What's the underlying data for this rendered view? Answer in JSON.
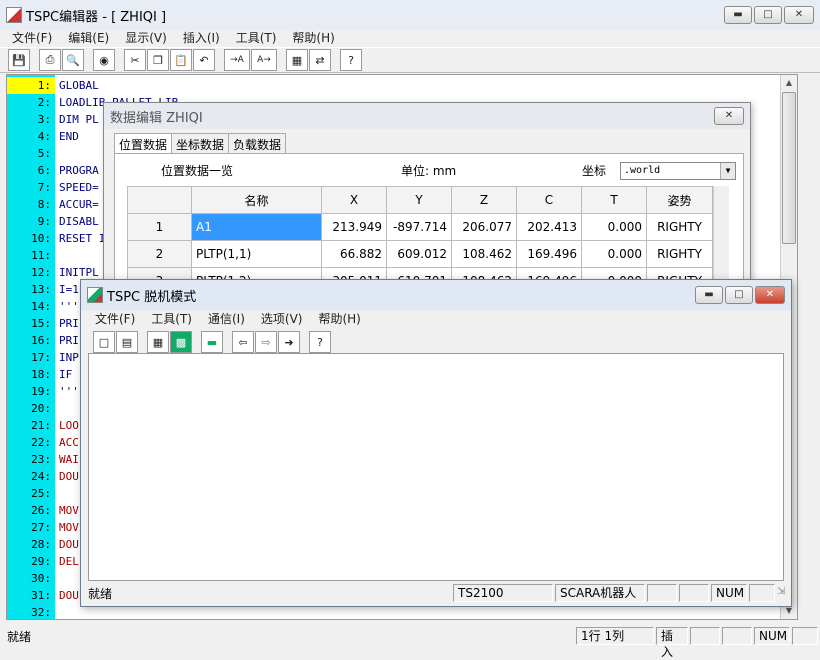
{
  "main": {
    "title": "TSPC编辑器 - [ ZHIQI ]",
    "menu": [
      "文件(F)",
      "编辑(E)",
      "显示(V)",
      "插入(I)",
      "工具(T)",
      "帮助(H)"
    ],
    "lines": [
      {
        "n": "1:",
        "code": "GLOBAL"
      },
      {
        "n": "2:",
        "code": "LOADLIB PALLET.LIB"
      },
      {
        "n": "3:",
        "code": "DIM PL"
      },
      {
        "n": "4:",
        "code": "END"
      },
      {
        "n": "5:",
        "code": ""
      },
      {
        "n": "6:",
        "code": "PROGRA"
      },
      {
        "n": "7:",
        "code": "SPEED="
      },
      {
        "n": "8:",
        "code": "ACCUR="
      },
      {
        "n": "9:",
        "code": "DISABL"
      },
      {
        "n": "10:",
        "code": "RESET I"
      },
      {
        "n": "11:",
        "code": ""
      },
      {
        "n": "12:",
        "code": "INITPL"
      },
      {
        "n": "13:",
        "code": "I=1"
      },
      {
        "n": "14:",
        "code": "'''"
      },
      {
        "n": "15:",
        "code": "PRI"
      },
      {
        "n": "16:",
        "code": "PRI"
      },
      {
        "n": "17:",
        "code": "INP"
      },
      {
        "n": "18:",
        "code": "IF"
      },
      {
        "n": "19:",
        "code": "'''"
      },
      {
        "n": "20:",
        "code": ""
      },
      {
        "n": "21:",
        "code": "LOO"
      },
      {
        "n": "22:",
        "code": "ACC"
      },
      {
        "n": "23:",
        "code": "WAI"
      },
      {
        "n": "24:",
        "code": "DOU"
      },
      {
        "n": "25:",
        "code": ""
      },
      {
        "n": "26:",
        "code": "MOV"
      },
      {
        "n": "27:",
        "code": "MOV"
      },
      {
        "n": "28:",
        "code": "DOU"
      },
      {
        "n": "29:",
        "code": "DEL"
      },
      {
        "n": "30:",
        "code": ""
      },
      {
        "n": "31:",
        "code": "DOU"
      },
      {
        "n": "32:",
        "code": ""
      }
    ],
    "status": {
      "ready": "就绪",
      "position": "1行 1列",
      "mode": "插入",
      "num": "NUM"
    }
  },
  "data_editor": {
    "title": "数据编辑 ZHIQI",
    "tabs": [
      "位置数据",
      "坐标数据",
      "负载数据"
    ],
    "list_label": "位置数据一览",
    "unit_label": "单位:  mm",
    "coord_label": "坐标",
    "coord_value": ".world",
    "columns": [
      "",
      "名称",
      "X",
      "Y",
      "Z",
      "C",
      "T",
      "姿势"
    ],
    "rows": [
      [
        "1",
        "A1",
        "213.949",
        "-897.714",
        "206.077",
        "202.413",
        "0.000",
        "RIGHTY"
      ],
      [
        "2",
        "PLTP(1,1)",
        "66.882",
        "609.012",
        "108.462",
        "169.496",
        "0.000",
        "RIGHTY"
      ],
      [
        "3",
        "PLTP(1,2)",
        "305.011",
        "610.701",
        "108.462",
        "169.496",
        "0.000",
        "RIGHTY"
      ]
    ]
  },
  "offline": {
    "title": "TSPC 脱机模式",
    "menu": [
      "文件(F)",
      "工具(T)",
      "通信(I)",
      "选项(V)",
      "帮助(H)"
    ],
    "status": {
      "ready": "就绪",
      "controller": "TS2100",
      "robot": "SCARA机器人",
      "num": "NUM"
    }
  }
}
